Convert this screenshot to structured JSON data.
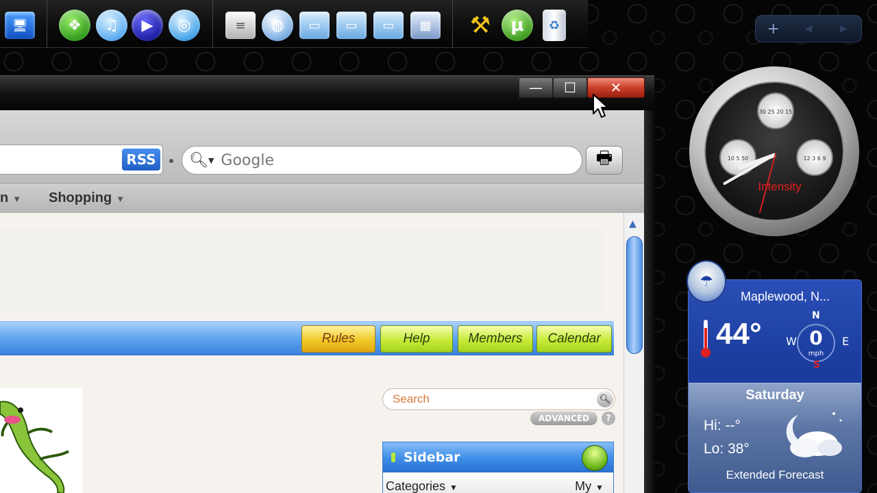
{
  "dock": {
    "items": [
      {
        "name": "my-computer",
        "glyph": "🖥"
      },
      {
        "name": "windows",
        "glyph": "❖"
      },
      {
        "name": "itunes",
        "glyph": "♫"
      },
      {
        "name": "media-player",
        "glyph": "▶"
      },
      {
        "name": "cd-burner",
        "glyph": "◎"
      },
      {
        "name": "notepad",
        "glyph": "≡"
      },
      {
        "name": "internet",
        "glyph": "◍"
      },
      {
        "name": "folder-1",
        "glyph": "▭"
      },
      {
        "name": "folder-2",
        "glyph": "▭"
      },
      {
        "name": "folder-3",
        "glyph": "▭"
      },
      {
        "name": "control-panel",
        "glyph": "▦"
      },
      {
        "name": "tools",
        "glyph": "⚒"
      },
      {
        "name": "utorrent",
        "glyph": "µ"
      },
      {
        "name": "recycle-bin",
        "glyph": "♻"
      }
    ],
    "controls": {
      "add": "+",
      "prev": "◀",
      "next": "▶"
    }
  },
  "window": {
    "buttons": {
      "minimize": "—",
      "maximize": "☐",
      "close": "✕"
    },
    "toolbar": {
      "rss_label": "RSS",
      "search_placeholder": "Google",
      "print_glyph": "🖶"
    },
    "bookmarks": [
      {
        "label": "n",
        "arrow": "▼"
      },
      {
        "label": "Shopping",
        "arrow": "▼"
      }
    ]
  },
  "site": {
    "nav": {
      "rules": "Rules",
      "help": "Help",
      "members": "Members",
      "calendar": "Calendar"
    },
    "search_placeholder": "Search",
    "advanced_label": "ADVANCED",
    "help_glyph": "?",
    "sidebar": {
      "title": "Sidebar",
      "categories": "Categories",
      "my": "My",
      "arrow": "▼"
    }
  },
  "clock": {
    "brand": "Intensity",
    "subdials": [
      "30 25 20 15",
      "10 5 50",
      "12 3 6 9"
    ]
  },
  "weather": {
    "location": "Maplewood, N...",
    "temperature": "44°",
    "wind": {
      "value": "0",
      "unit": "mph",
      "n": "N",
      "s": "S",
      "e": "E",
      "w": "W"
    },
    "day": "Saturday",
    "hi": "Hi: --°",
    "lo": "Lo: 38°",
    "forecast_link": "Extended Forecast"
  },
  "colors": {
    "accent_blue": "#3a82dd",
    "nav_green": "#c8ea38",
    "nav_yellow": "#f0c828",
    "close_red": "#c8402a",
    "clock_brand": "#e41e1e"
  }
}
